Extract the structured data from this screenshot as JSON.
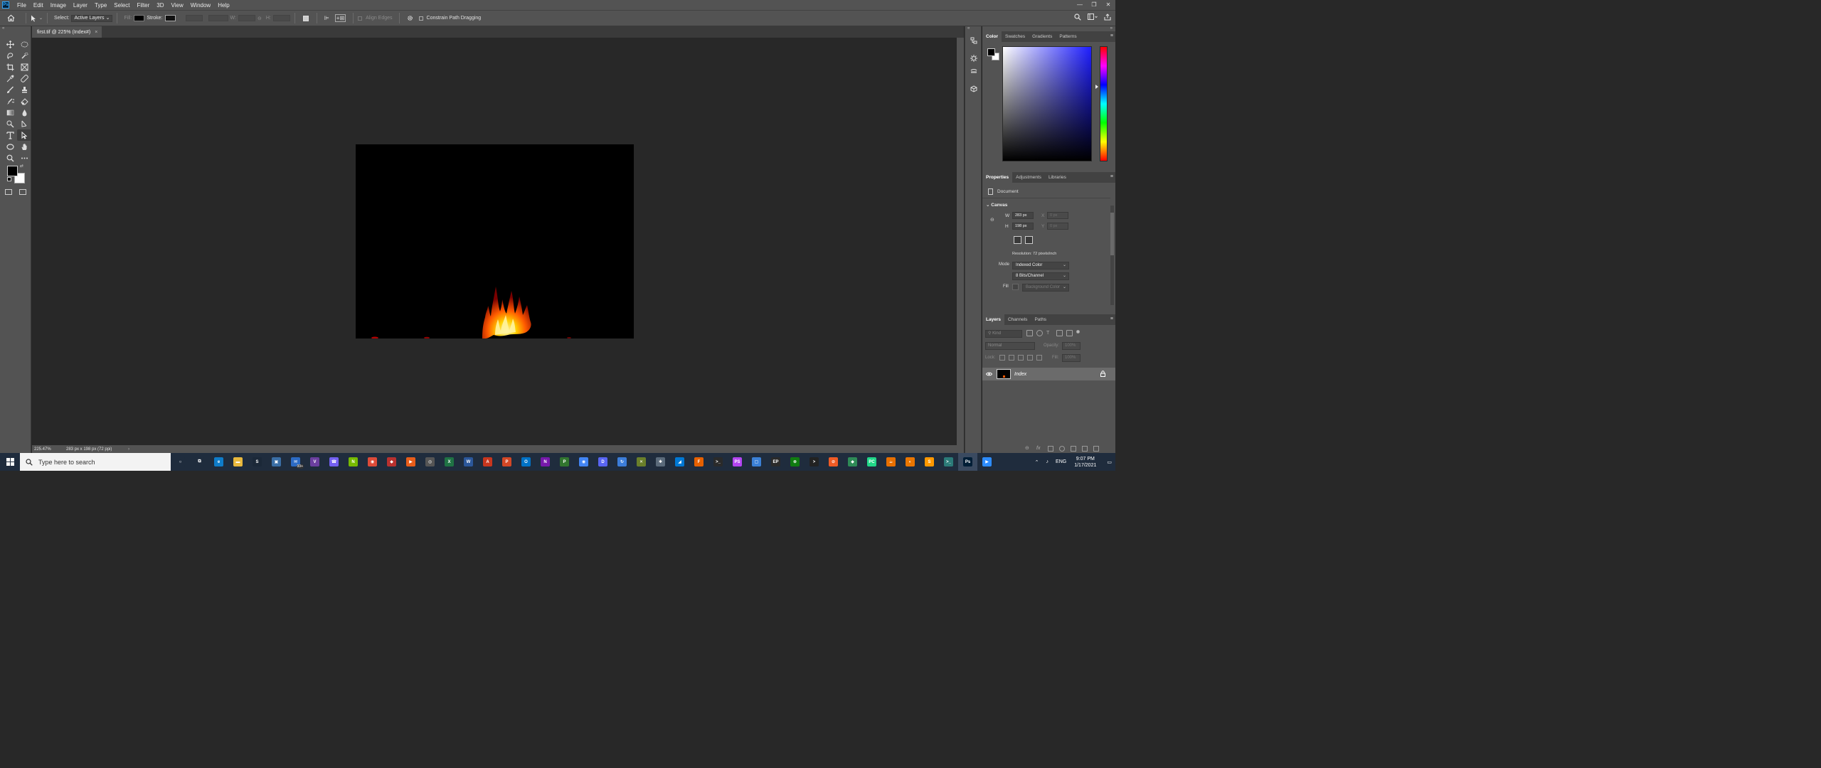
{
  "menubar": {
    "items": [
      "File",
      "Edit",
      "Image",
      "Layer",
      "Type",
      "Select",
      "Filter",
      "3D",
      "View",
      "Window",
      "Help"
    ],
    "window_controls": [
      "—",
      "❐",
      "✕"
    ]
  },
  "options": {
    "select_label": "Select:",
    "select_value": "Active Layers",
    "fill_label": "Fill:",
    "stroke_label": "Stroke:",
    "w_label": "W:",
    "h_label": "H:",
    "align_edges": "Align Edges",
    "constrain_path": "Constrain Path Dragging"
  },
  "document": {
    "tab_title": "first.tif @ 225% (Index#)",
    "close_glyph": "×",
    "zoom": "225.47%",
    "info": "283 px x 198 px (72 ppi)",
    "status_arrow": "›"
  },
  "color_panel": {
    "tabs": [
      "Color",
      "Swatches",
      "Gradients",
      "Patterns"
    ],
    "fg_color": "#000000",
    "bg_color": "#ffffff"
  },
  "properties_panel": {
    "tabs": [
      "Properties",
      "Adjustments",
      "Libraries"
    ],
    "doc_label": "Document",
    "section": "Canvas",
    "w_label": "W",
    "w_value": "283 px",
    "h_label": "H",
    "h_value": "198 px",
    "x_label": "X",
    "x_value": "0 px",
    "y_label": "Y",
    "y_value": "0 px",
    "resolution": "Resolution: 72 pixels/inch",
    "mode_label": "Mode",
    "mode_value": "Indexed Color",
    "depth_value": "8 Bits/Channel",
    "fill_label": "Fill",
    "fill_value": "Background Color"
  },
  "layers_panel": {
    "tabs": [
      "Layers",
      "Channels",
      "Paths"
    ],
    "search_placeholder": "Kind",
    "blend_mode": "Normal",
    "opacity_label": "Opacity:",
    "opacity_value": "100%",
    "lock_label": "Lock:",
    "fill_label": "Fill:",
    "fill_value": "100%",
    "layers": [
      {
        "name": "Index",
        "visible": true,
        "locked": true
      }
    ]
  },
  "taskbar": {
    "search_placeholder": "Type here to search",
    "badge": "99+",
    "lang": "ENG",
    "time": "9:07 PM",
    "date": "1/17/2021",
    "app_icons": [
      {
        "name": "cortana-icon",
        "color": "#1f2c3d",
        "glyph": "○"
      },
      {
        "name": "task-view-icon",
        "color": "#1f2c3d",
        "glyph": "⧉"
      },
      {
        "name": "edge-icon",
        "color": "#0f7cc9",
        "glyph": "e"
      },
      {
        "name": "file-explorer-icon",
        "color": "#e8b83d",
        "glyph": "▬"
      },
      {
        "name": "steam-icon",
        "color": "#1b2838",
        "glyph": "S"
      },
      {
        "name": "store-icon",
        "color": "#3a6ea5",
        "glyph": "▣"
      },
      {
        "name": "mail-icon",
        "color": "#2c6bc4",
        "glyph": "✉"
      },
      {
        "name": "visual-studio-icon",
        "color": "#6b3fa0",
        "glyph": "V"
      },
      {
        "name": "viber-icon",
        "color": "#7360f2",
        "glyph": "☎"
      },
      {
        "name": "nvidia-icon",
        "color": "#76b900",
        "glyph": "N"
      },
      {
        "name": "chrome-icon",
        "color": "#dd4b39",
        "glyph": "◉"
      },
      {
        "name": "antivirus-icon",
        "color": "#b8312f",
        "glyph": "◆"
      },
      {
        "name": "media-player-icon",
        "color": "#e85d1a",
        "glyph": "▶"
      },
      {
        "name": "disc-icon",
        "color": "#555555",
        "glyph": "◎"
      },
      {
        "name": "excel-icon",
        "color": "#1f7244",
        "glyph": "X"
      },
      {
        "name": "word-icon",
        "color": "#2b579a",
        "glyph": "W"
      },
      {
        "name": "acrobat-icon",
        "color": "#c7361e",
        "glyph": "A"
      },
      {
        "name": "powerpoint-icon",
        "color": "#d24726",
        "glyph": "P"
      },
      {
        "name": "outlook-icon",
        "color": "#0072c6",
        "glyph": "O"
      },
      {
        "name": "onenote-icon",
        "color": "#7719aa",
        "glyph": "N"
      },
      {
        "name": "project-icon",
        "color": "#31752f",
        "glyph": "P"
      },
      {
        "name": "chrome-beta-icon",
        "color": "#4285f4",
        "glyph": "◉"
      },
      {
        "name": "discord-icon",
        "color": "#5865f2",
        "glyph": "D"
      },
      {
        "name": "sync-icon",
        "color": "#3c7dd9",
        "glyph": "↻"
      },
      {
        "name": "tools-icon",
        "color": "#6a7f2a",
        "glyph": "✕"
      },
      {
        "name": "puzzle-icon",
        "color": "#5a6a7a",
        "glyph": "✱"
      },
      {
        "name": "vscode-icon",
        "color": "#0078d4",
        "glyph": "◢"
      },
      {
        "name": "firefox-icon",
        "color": "#e66000",
        "glyph": "F"
      },
      {
        "name": "terminal-icon",
        "color": "#2a2a2a",
        "glyph": ">_"
      },
      {
        "name": "phpstorm-icon",
        "color": "#b345f1",
        "glyph": "PS"
      },
      {
        "name": "box-icon",
        "color": "#3b80d6",
        "glyph": "▢"
      },
      {
        "name": "epic-games-icon",
        "color": "#2a2a2a",
        "glyph": "EP"
      },
      {
        "name": "xbox-icon",
        "color": "#107c10",
        "glyph": "⊗"
      },
      {
        "name": "console-icon",
        "color": "#222222",
        "glyph": ">"
      },
      {
        "name": "postman-icon",
        "color": "#ef5b25",
        "glyph": "⊘"
      },
      {
        "name": "git-icon",
        "color": "#2e8b57",
        "glyph": "◆"
      },
      {
        "name": "pycharm-icon",
        "color": "#21d789",
        "glyph": "PC"
      },
      {
        "name": "java-icon",
        "color": "#e76f00",
        "glyph": "☕"
      },
      {
        "name": "blender-icon",
        "color": "#ea7600",
        "glyph": "◐"
      },
      {
        "name": "sublime-icon",
        "color": "#ff9800",
        "glyph": "S"
      },
      {
        "name": "terminal2-icon",
        "color": "#2b7a78",
        "glyph": ">_"
      },
      {
        "name": "photoshop-icon",
        "color": "#001e36",
        "glyph": "Ps",
        "active": true
      },
      {
        "name": "zoom-icon",
        "color": "#2d8cff",
        "glyph": "▶"
      }
    ]
  }
}
